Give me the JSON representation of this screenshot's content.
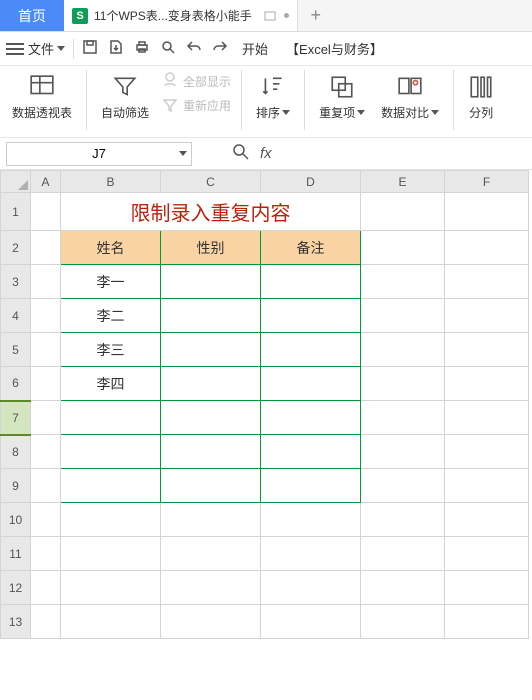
{
  "tabs": {
    "home": "首页",
    "doc_icon": "S",
    "doc_label": "11个WPS表...变身表格小能手"
  },
  "menu": {
    "file": "文件",
    "start": "开始",
    "group": "【Excel与财务】"
  },
  "ribbon": {
    "pivot": "数据透视表",
    "autofilter": "自动筛选",
    "showall": "全部显示",
    "reapply": "重新应用",
    "sort": "排序",
    "duplicates": "重复项",
    "compare": "数据对比",
    "split": "分列"
  },
  "namebox": {
    "value": "J7"
  },
  "fx": {
    "label": "fx",
    "value": ""
  },
  "sheet": {
    "cols": [
      "A",
      "B",
      "C",
      "D",
      "E",
      "F"
    ],
    "rows": [
      "1",
      "2",
      "3",
      "4",
      "5",
      "6",
      "7",
      "8",
      "9",
      "10",
      "11",
      "12",
      "13"
    ],
    "title": "限制录入重复内容",
    "headers": {
      "name": "姓名",
      "gender": "性别",
      "note": "备注"
    },
    "data": [
      "李一",
      "李二",
      "李三",
      "李四"
    ]
  }
}
